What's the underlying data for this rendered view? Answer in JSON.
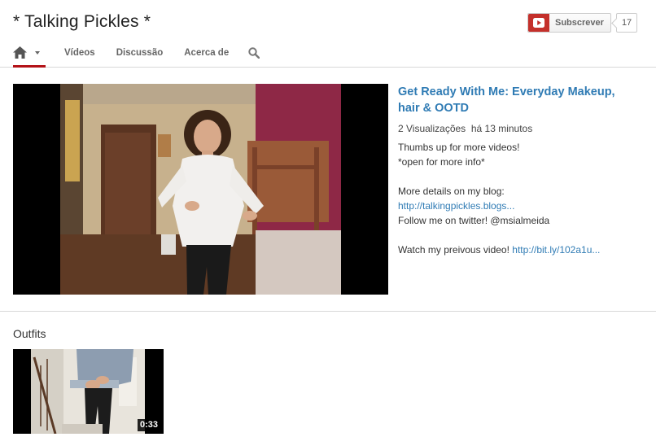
{
  "channel": {
    "title": "* Talking Pickles *"
  },
  "subscribe": {
    "label": "Subscrever",
    "count": "17",
    "icon": "youtube-play-icon",
    "accent": "#c4302b"
  },
  "nav": {
    "home_icon": "home-icon",
    "tabs": [
      {
        "label": "Vídeos"
      },
      {
        "label": "Discussão"
      },
      {
        "label": "Acerca de"
      }
    ],
    "search_icon": "search-icon",
    "active_underline": "#b31217"
  },
  "featured": {
    "title": "Get Ready With Me: Everyday Makeup, hair & OOTD",
    "views": "2 Visualizações",
    "age": "há 13 minutos",
    "description": {
      "line1": "Thumbs up for more videos!",
      "line2": "*open for more info*",
      "line3": "More details on my blog:",
      "blog_link": "http://talkingpickles.blogs...",
      "line4": "Follow me on twitter! @msialmeida",
      "line5": "Watch my preivous video!",
      "prev_link": "http://bit.ly/102a1u..."
    },
    "link_color": "#2f7bb4"
  },
  "section": {
    "title": "Outfits",
    "video": {
      "duration": "0:33"
    }
  }
}
